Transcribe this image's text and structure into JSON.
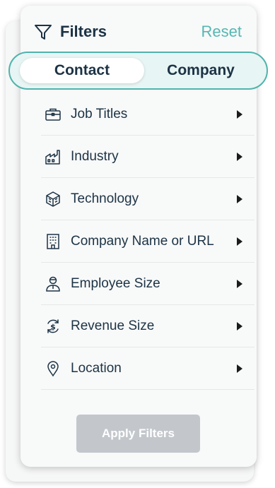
{
  "header": {
    "title": "Filters",
    "reset_label": "Reset"
  },
  "tabs": [
    {
      "label": "Contact",
      "selected": true
    },
    {
      "label": "Company",
      "selected": false
    }
  ],
  "filters": [
    {
      "label": "Job Titles",
      "icon": "briefcase-icon"
    },
    {
      "label": "Industry",
      "icon": "factory-icon"
    },
    {
      "label": "Technology",
      "icon": "cube-icon"
    },
    {
      "label": "Company Name or URL",
      "icon": "building-icon"
    },
    {
      "label": "Employee Size",
      "icon": "person-icon"
    },
    {
      "label": "Revenue Size",
      "icon": "dollar-cycle-icon"
    },
    {
      "label": "Location",
      "icon": "location-pin-icon"
    }
  ],
  "apply_label": "Apply Filters",
  "colors": {
    "accent": "#55b7b2",
    "text": "#1c3345",
    "button_disabled": "#c3c7cc"
  }
}
